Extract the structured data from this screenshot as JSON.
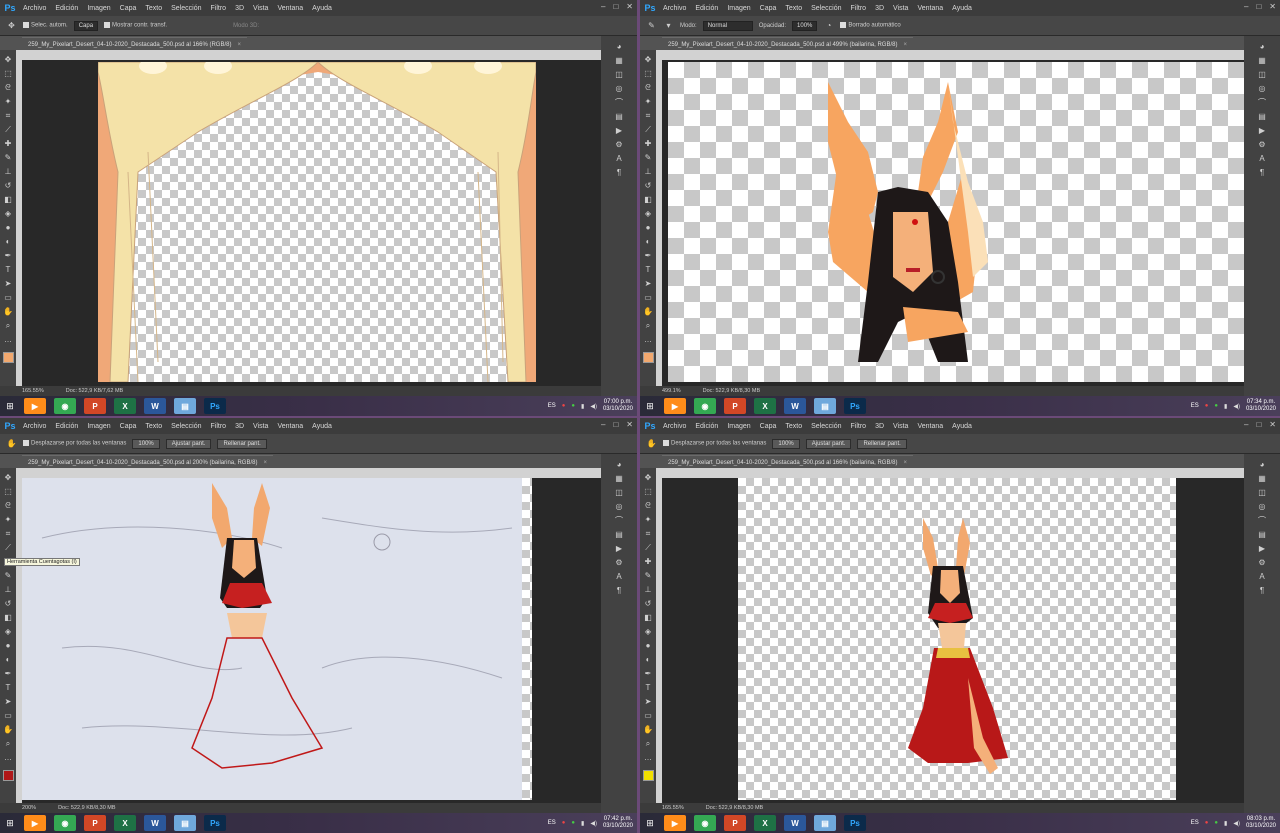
{
  "menus": [
    "Archivo",
    "Edición",
    "Imagen",
    "Capa",
    "Texto",
    "Selección",
    "Filtro",
    "3D",
    "Vista",
    "Ventana",
    "Ayuda"
  ],
  "ps_logo": "Ps",
  "window_controls": [
    "–",
    "□",
    "✕"
  ],
  "panes": [
    {
      "options": {
        "auto_select": "Selec. autom.",
        "layer": "Capa",
        "show_transform": "Mostrar contr. transf.",
        "mode3d": "Modo 3D:"
      },
      "doc_title": "259_My_Pixelart_Desert_04-10-2020_Destacada_500.psd al 166% (RGB/8)",
      "zoom": "165.55%",
      "doc_size": "Doc: 522,9 KB/7,62 MB",
      "fg_color": "#f2a86e"
    },
    {
      "options": {
        "mode_label": "Modo:",
        "mode_value": "Normal",
        "opacity_label": "Opacidad:",
        "opacity_value": "100%",
        "auto_erase": "Borrado automático"
      },
      "doc_title": "259_My_Pixelart_Desert_04-10-2020_Destacada_500.psd al 499% (bailarina, RGB/8)",
      "zoom": "499.1%",
      "doc_size": "Doc: 522,9 KB/8,30 MB",
      "fg_color": "#f2a86e"
    },
    {
      "options": {
        "scroll_all": "Desplazarse por todas las ventanas",
        "zoom100": "100%",
        "fit": "Ajustar pant.",
        "fill": "Rellenar pant."
      },
      "doc_title": "259_My_Pixelart_Desert_04-10-2020_Destacada_500.psd al 200% (bailarina, RGB/8)",
      "zoom": "200%",
      "doc_size": "Doc: 522,9 KB/8,30 MB",
      "fg_color": "#b01818",
      "tooltip": "Herramienta Cuentagotas (I)"
    },
    {
      "options": {
        "scroll_all": "Desplazarse por todas las ventanas",
        "zoom100": "100%",
        "fit": "Ajustar pant.",
        "fill": "Rellenar pant."
      },
      "doc_title": "259_My_Pixelart_Desert_04-10-2020_Destacada_500.psd al 166% (bailarina, RGB/8)",
      "zoom": "165.55%",
      "doc_size": "Doc: 522,9 KB/8,30 MB",
      "fg_color": "#f2e000"
    }
  ],
  "taskbars": [
    {
      "lang": "ES",
      "time": "07:00 p.m.",
      "date": "03/10/2020"
    },
    {
      "lang": "ES",
      "time": "07:34 p.m.",
      "date": "03/10/2020"
    },
    {
      "lang": "ES",
      "time": "07:42 p.m.",
      "date": "03/10/2020"
    },
    {
      "lang": "ES",
      "time": "08:03 p.m.",
      "date": "03/10/2020"
    }
  ],
  "taskbar_apps": [
    {
      "name": "media-player-icon",
      "color": "#ff8c1a",
      "glyph": "▶"
    },
    {
      "name": "chrome-icon",
      "color": "#34a853",
      "glyph": "◉"
    },
    {
      "name": "powerpoint-icon",
      "color": "#d24726",
      "glyph": "P"
    },
    {
      "name": "excel-icon",
      "color": "#1e7145",
      "glyph": "X"
    },
    {
      "name": "word-icon",
      "color": "#2b579a",
      "glyph": "W"
    },
    {
      "name": "notepad-icon",
      "color": "#6fa8dc",
      "glyph": "▤"
    },
    {
      "name": "photoshop-icon",
      "color": "#0b2a4a",
      "glyph": "Ps"
    }
  ]
}
